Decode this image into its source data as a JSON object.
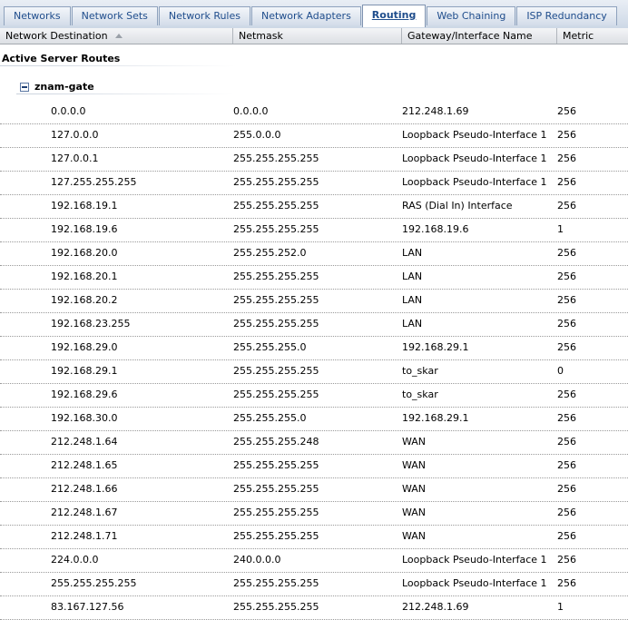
{
  "tabs": [
    {
      "label": "Networks",
      "active": false
    },
    {
      "label": "Network Sets",
      "active": false
    },
    {
      "label": "Network Rules",
      "active": false
    },
    {
      "label": "Network Adapters",
      "active": false
    },
    {
      "label": "Routing",
      "active": true
    },
    {
      "label": "Web Chaining",
      "active": false
    },
    {
      "label": "ISP Redundancy",
      "active": false
    }
  ],
  "columns": {
    "destination": "Network Destination",
    "netmask": "Netmask",
    "gateway": "Gateway/Interface Name",
    "metric": "Metric"
  },
  "section_title": "Active Server Routes",
  "group": "znam-gate",
  "routes": [
    {
      "destination": "0.0.0.0",
      "netmask": "0.0.0.0",
      "gateway": "212.248.1.69",
      "metric": "256"
    },
    {
      "destination": "127.0.0.0",
      "netmask": "255.0.0.0",
      "gateway": "Loopback Pseudo-Interface 1",
      "metric": "256"
    },
    {
      "destination": "127.0.0.1",
      "netmask": "255.255.255.255",
      "gateway": "Loopback Pseudo-Interface 1",
      "metric": "256"
    },
    {
      "destination": "127.255.255.255",
      "netmask": "255.255.255.255",
      "gateway": "Loopback Pseudo-Interface 1",
      "metric": "256"
    },
    {
      "destination": "192.168.19.1",
      "netmask": "255.255.255.255",
      "gateway": "RAS (Dial In) Interface",
      "metric": "256"
    },
    {
      "destination": "192.168.19.6",
      "netmask": "255.255.255.255",
      "gateway": "192.168.19.6",
      "metric": "1"
    },
    {
      "destination": "192.168.20.0",
      "netmask": "255.255.252.0",
      "gateway": "LAN",
      "metric": "256"
    },
    {
      "destination": "192.168.20.1",
      "netmask": "255.255.255.255",
      "gateway": "LAN",
      "metric": "256"
    },
    {
      "destination": "192.168.20.2",
      "netmask": "255.255.255.255",
      "gateway": "LAN",
      "metric": "256"
    },
    {
      "destination": "192.168.23.255",
      "netmask": "255.255.255.255",
      "gateway": "LAN",
      "metric": "256"
    },
    {
      "destination": "192.168.29.0",
      "netmask": "255.255.255.0",
      "gateway": "192.168.29.1",
      "metric": "256"
    },
    {
      "destination": "192.168.29.1",
      "netmask": "255.255.255.255",
      "gateway": "to_skar",
      "metric": "0"
    },
    {
      "destination": "192.168.29.6",
      "netmask": "255.255.255.255",
      "gateway": "to_skar",
      "metric": "256"
    },
    {
      "destination": "192.168.30.0",
      "netmask": "255.255.255.0",
      "gateway": "192.168.29.1",
      "metric": "256"
    },
    {
      "destination": "212.248.1.64",
      "netmask": "255.255.255.248",
      "gateway": "WAN",
      "metric": "256"
    },
    {
      "destination": "212.248.1.65",
      "netmask": "255.255.255.255",
      "gateway": "WAN",
      "metric": "256"
    },
    {
      "destination": "212.248.1.66",
      "netmask": "255.255.255.255",
      "gateway": "WAN",
      "metric": "256"
    },
    {
      "destination": "212.248.1.67",
      "netmask": "255.255.255.255",
      "gateway": "WAN",
      "metric": "256"
    },
    {
      "destination": "212.248.1.71",
      "netmask": "255.255.255.255",
      "gateway": "WAN",
      "metric": "256"
    },
    {
      "destination": "224.0.0.0",
      "netmask": "240.0.0.0",
      "gateway": "Loopback Pseudo-Interface 1",
      "metric": "256"
    },
    {
      "destination": "255.255.255.255",
      "netmask": "255.255.255.255",
      "gateway": "Loopback Pseudo-Interface 1",
      "metric": "256"
    },
    {
      "destination": "83.167.127.56",
      "netmask": "255.255.255.255",
      "gateway": "212.248.1.69",
      "metric": "1"
    }
  ]
}
